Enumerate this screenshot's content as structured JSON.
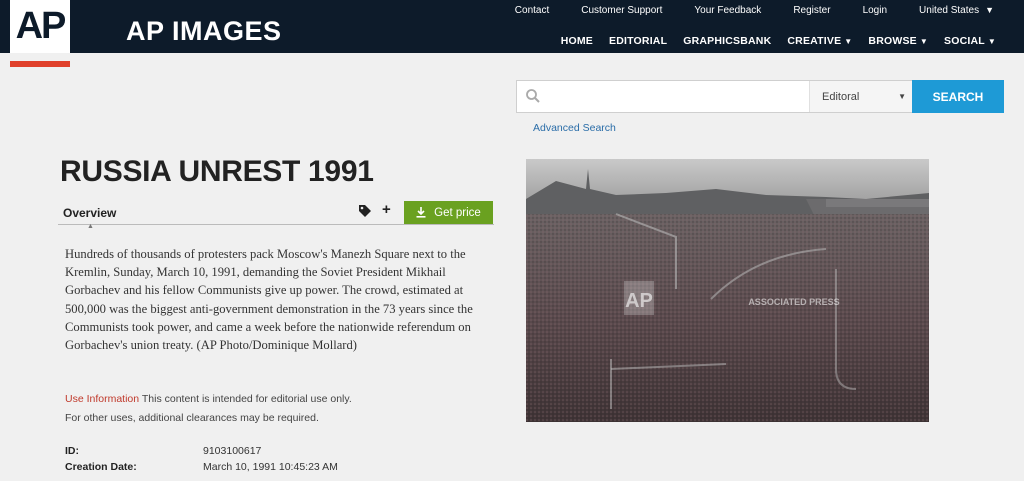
{
  "header": {
    "logo": "AP",
    "brand": "AP IMAGES",
    "utility_links": [
      "Contact",
      "Customer Support",
      "Your Feedback",
      "Register",
      "Login"
    ],
    "country": "United States",
    "nav": [
      {
        "label": "HOME",
        "dropdown": false
      },
      {
        "label": "EDITORIAL",
        "dropdown": false
      },
      {
        "label": "GRAPHICSBANK",
        "dropdown": false
      },
      {
        "label": "CREATIVE",
        "dropdown": true
      },
      {
        "label": "BROWSE",
        "dropdown": true
      },
      {
        "label": "SOCIAL",
        "dropdown": true
      }
    ]
  },
  "search": {
    "placeholder": "",
    "filter_selected": "Editoral",
    "button_label": "SEARCH",
    "advanced_link": "Advanced Search"
  },
  "item": {
    "title": "RUSSIA UNREST 1991",
    "tab_label": "Overview",
    "price_button": "Get price",
    "description": "Hundreds of thousands of protesters pack Moscow's Manezh Square next to the Kremlin, Sunday, March 10, 1991, demanding the Soviet President Mikhail Gorbachev and his fellow Communists give up power. The crowd, estimated at 500,000 was the biggest anti-government demonstration in the 73 years since the Communists took power, and came a week before the nationwide referendum on Gorbachev's union treaty. (AP Photo/Dominique Mollard)",
    "usage_label": "Use Information",
    "usage_text": "This content is intended for editorial use only.",
    "usage_text_2": "For other uses, additional clearances may be required.",
    "meta": [
      {
        "label": "ID:",
        "value": "9103100617"
      },
      {
        "label": "Creation Date:",
        "value": "March 10, 1991 10:45:23 AM"
      }
    ]
  },
  "photo": {
    "watermark": "AP",
    "watermark_text": "ASSOCIATED PRESS"
  },
  "colors": {
    "header_bg": "#0d1b2a",
    "logo_accent": "#e0402b",
    "search_button": "#1e9ad6",
    "price_button": "#6aa120",
    "link": "#2a6da8"
  }
}
